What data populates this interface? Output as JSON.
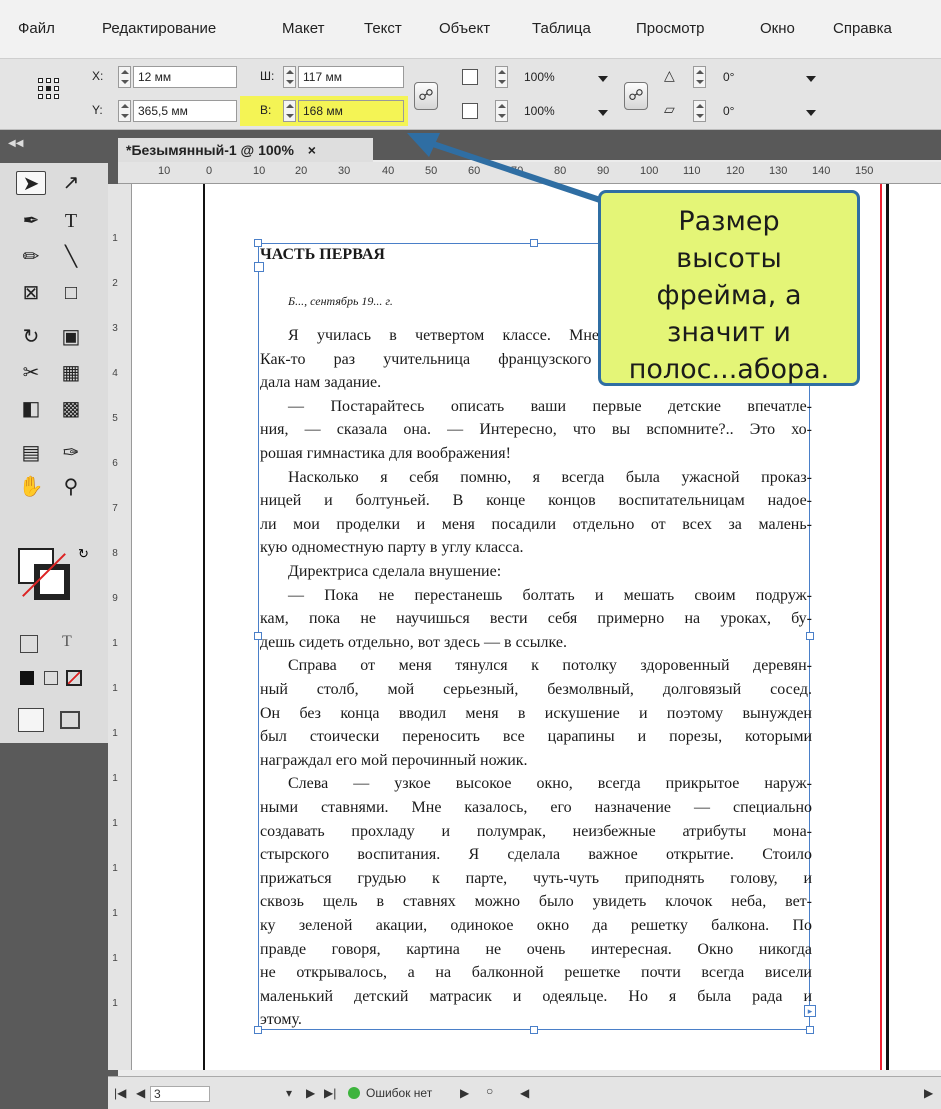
{
  "menu": [
    "Файл",
    "Редактирование",
    "Макет",
    "Текст",
    "Объект",
    "Таблица",
    "Просмотр",
    "Окно",
    "Справка"
  ],
  "control_panel": {
    "x_label": "X:",
    "x_value": "12 мм",
    "y_label": "Y:",
    "y_value": "365,5 мм",
    "w_label": "Ш:",
    "w_value": "117 мм",
    "h_label": "В:",
    "h_value": "168 мм",
    "scale_x": "100%",
    "scale_y": "100%",
    "rotate": "0°",
    "shear": "0°",
    "highlight_color": "#f4f455"
  },
  "tab": {
    "title": "*Безымянный-1 @ 100%",
    "close": "×"
  },
  "ruler": {
    "h_ticks": [
      "10",
      "0",
      "10",
      "20",
      "30",
      "40",
      "50",
      "60",
      "70",
      "80",
      "90",
      "100",
      "110",
      "120",
      "130",
      "140",
      "150"
    ],
    "v_ticks": [
      "1",
      "2",
      "3",
      "4",
      "5",
      "6",
      "7",
      "8",
      "9",
      "1",
      "1",
      "1",
      "1",
      "1",
      "1",
      "1",
      "1",
      "1"
    ]
  },
  "document": {
    "heading": "ЧАСТЬ ПЕРВАЯ",
    "dateline": "Б..., сентябрь 19... г.",
    "lines": [
      {
        "t": "Я училась в четвертом классе. Мне было тогда десять лет.",
        "c": "ind"
      },
      {
        "t": "Как-то раз учительница французского языка мадам Таранта",
        "c": ""
      },
      {
        "t": "дала нам задание.",
        "c": "last"
      },
      {
        "t": "— Постарайтесь описать ваши первые детские впечатле-",
        "c": "ind"
      },
      {
        "t": "ния, — сказала она. — Интересно, что вы вспомните?.. Это хо-",
        "c": ""
      },
      {
        "t": "рошая гимнастика для воображения!",
        "c": "last"
      },
      {
        "t": "Насколько я себя помню, я всегда была ужасной проказ-",
        "c": "ind"
      },
      {
        "t": "ницей и болтуньей. В конце концов воспитательницам надое-",
        "c": ""
      },
      {
        "t": "ли мои проделки и меня посадили отдельно от всех за малень-",
        "c": ""
      },
      {
        "t": "кую одноместную парту в углу класса.",
        "c": "last"
      },
      {
        "t": "Директриса сделала внушение:",
        "c": "ind last"
      },
      {
        "t": "— Пока не перестанешь болтать и мешать своим подруж-",
        "c": "ind"
      },
      {
        "t": "кам, пока не научишься вести себя примерно на уроках, бу-",
        "c": ""
      },
      {
        "t": "дешь сидеть отдельно, вот здесь — в ссылке.",
        "c": "last"
      },
      {
        "t": "Справа от меня тянулся к потолку здоровенный деревян-",
        "c": "ind"
      },
      {
        "t": "ный столб, мой серьезный, безмолвный, долговязый сосед.",
        "c": ""
      },
      {
        "t": "Он без конца вводил меня в искушение и поэтому вынужден",
        "c": ""
      },
      {
        "t": "был стоически переносить все царапины и порезы, которыми",
        "c": ""
      },
      {
        "t": "награждал его мой перочинный ножик.",
        "c": "last"
      },
      {
        "t": "Слева — узкое высокое окно, всегда прикрытое наруж-",
        "c": "ind"
      },
      {
        "t": "ными ставнями. Мне казалось, его назначение — специально",
        "c": ""
      },
      {
        "t": "создавать прохладу и полумрак, неизбежные атрибуты мона-",
        "c": ""
      },
      {
        "t": "стырского воспитания. Я сделала важное открытие. Стоило",
        "c": ""
      },
      {
        "t": "прижаться грудью к парте, чуть-чуть приподнять голову, и",
        "c": ""
      },
      {
        "t": "сквозь щель в ставнях можно было увидеть клочок неба, вет-",
        "c": ""
      },
      {
        "t": "ку зеленой акации, одинокое окно да решетку балкона. По",
        "c": ""
      },
      {
        "t": "правде говоря, картина не очень интересная. Окно никогда",
        "c": ""
      },
      {
        "t": "не открывалось, а на балконной решетке почти всегда висели",
        "c": ""
      },
      {
        "t": "маленький детский матрасик и одеяльце. Но я была рада и",
        "c": ""
      },
      {
        "t": "этому.",
        "c": "last"
      }
    ]
  },
  "callout": {
    "line1": "Размер",
    "line2": "высоты",
    "line3": "фрейма, а",
    "line4": "значит и",
    "line5": "полос...абора."
  },
  "status": {
    "page": "3",
    "errors": "Ошибок нет"
  }
}
